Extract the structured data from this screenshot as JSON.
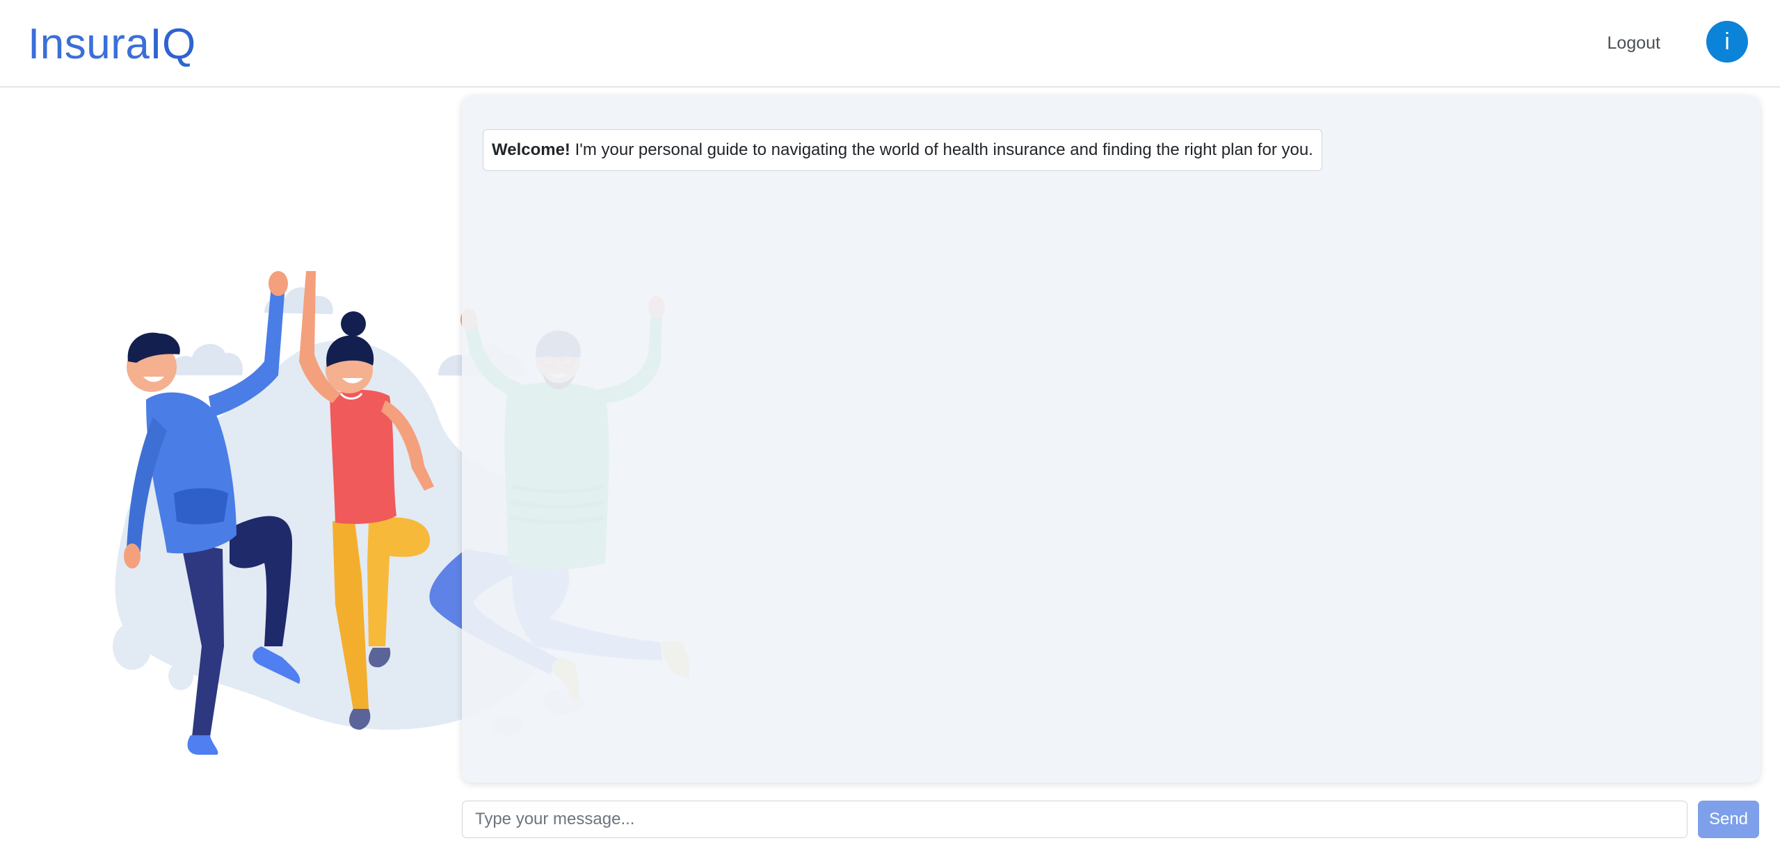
{
  "header": {
    "brand_main": "Insura",
    "brand_accent": "IQ",
    "logout_label": "Logout",
    "avatar_letter": "i"
  },
  "chat": {
    "welcome_bold": "Welcome!",
    "welcome_text": " I'm your personal guide to navigating the world of health insurance and finding the right plan for you."
  },
  "composer": {
    "placeholder": "Type your message...",
    "value": "",
    "send_label": "Send"
  },
  "illustration": {
    "name": "jumping-people-illustration"
  },
  "colors": {
    "brand": "#3b6fd8",
    "avatar": "#0b83d9",
    "send_button": "#7ea0ea",
    "panel_bg": "#f0f3f7"
  }
}
